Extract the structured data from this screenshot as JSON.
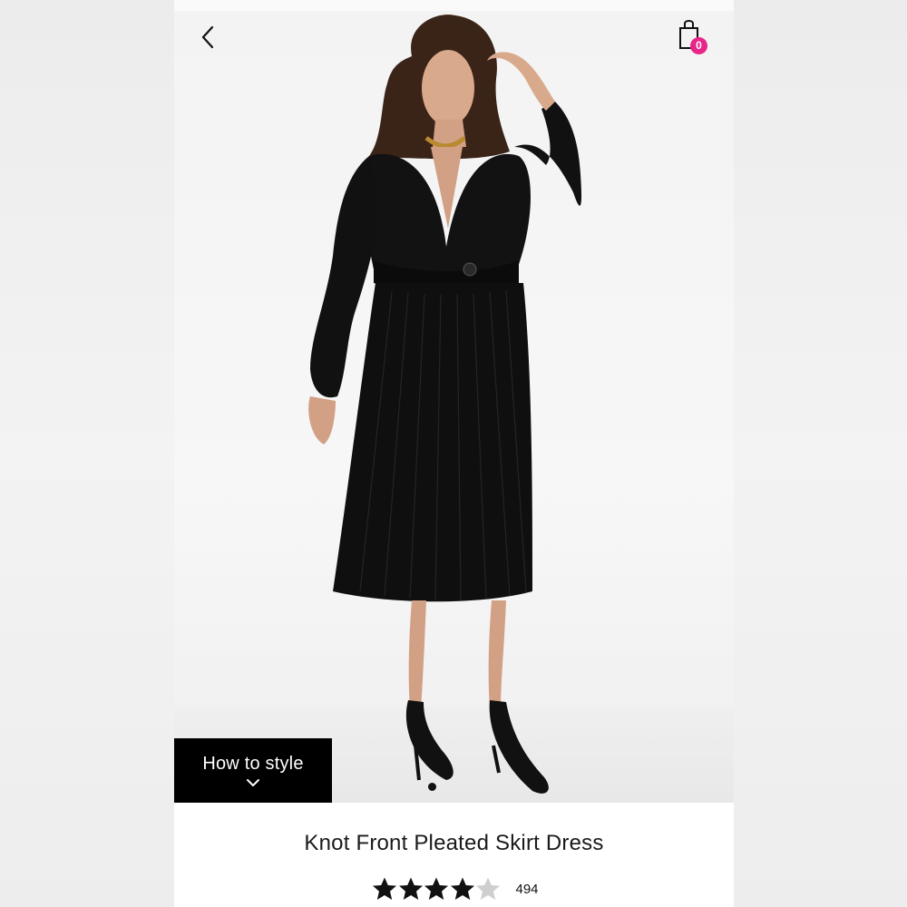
{
  "header": {
    "back_icon": "chevron-left-icon",
    "bag_icon": "shopping-bag-icon",
    "bag_count": "0",
    "bag_badge_color": "#e8268a"
  },
  "gallery": {
    "how_to_style_label": "How to style",
    "how_to_style_icon": "chevron-down-icon",
    "active_slide": 1
  },
  "product": {
    "title": "Knot Front Pleated Skirt Dress",
    "rating": 4,
    "rating_max": 5,
    "review_count": "494"
  },
  "colors": {
    "accent": "#e8268a",
    "text": "#1a1a1a",
    "star_filled": "#111111",
    "star_empty": "#cfcfcf"
  }
}
